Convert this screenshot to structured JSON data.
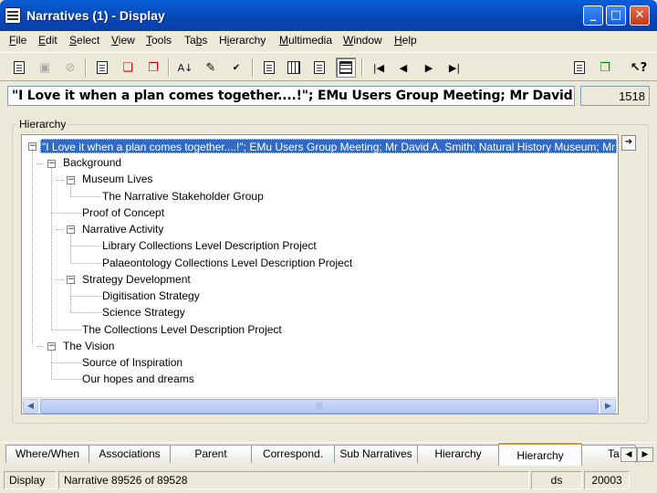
{
  "window": {
    "title": "Narratives (1) - Display",
    "buttons": {
      "minimize": "_",
      "maximize": "□",
      "close": "✕"
    }
  },
  "menu": [
    {
      "label": "File",
      "accel": "F",
      "rest": "ile"
    },
    {
      "label": "Edit",
      "accel": "E",
      "rest": "dit"
    },
    {
      "label": "Select",
      "accel": "S",
      "rest": "elect"
    },
    {
      "label": "View",
      "accel": "V",
      "rest": "iew"
    },
    {
      "label": "Tools",
      "accel": "T",
      "rest": "ools"
    },
    {
      "label": "Tabs",
      "pre": "Ta",
      "accel": "b",
      "rest": "s"
    },
    {
      "label": "Hierarchy",
      "pre": "H",
      "accel": "i",
      "rest": "erarchy"
    },
    {
      "label": "Multimedia",
      "accel": "M",
      "rest": "ultimedia"
    },
    {
      "label": "Window",
      "accel": "W",
      "rest": "indow"
    },
    {
      "label": "Help",
      "accel": "H",
      "rest": "elp"
    }
  ],
  "toolbar_icons": [
    "new-record-icon",
    "save-icon",
    "cancel-icon",
    "search-icon",
    "search-options-icon",
    "clear-icon",
    "sort-icon",
    "edit-icon",
    "spell-check-icon",
    "page-view-icon",
    "list-view-icon",
    "detail-view-icon",
    "hierarchy-view-icon",
    "first-record-icon",
    "previous-record-icon",
    "next-record-icon",
    "last-record-icon",
    "copy-record-icon",
    "duplicate-record-icon",
    "whats-this-help-icon"
  ],
  "summary": {
    "text": "\"I Love it when a plan comes together....!\"; EMu Users Group Meeting; Mr David A. Smith; Natur",
    "record_number": "1518"
  },
  "hierarchy": {
    "group_label": "Hierarchy",
    "root": "\"I Love it when a plan comes together....!\"; EMu Users Group Meeting; Mr David A. Smith; Natural History Museum; Mr",
    "nodes": {
      "background": "Background",
      "museum_lives": "Museum Lives",
      "stakeholder": "The Narrative Stakeholder Group",
      "proof": "Proof of Concept",
      "narrative_activity": "Narrative Activity",
      "library": "Library Collections Level Description Project",
      "palaeontology": "Palaeontology Collections Level Description Project",
      "strategy": "Strategy Development",
      "digitisation": "Digitisation Strategy",
      "science": "Science Strategy",
      "clds_project": "The Collections Level Description Project",
      "vision": "The Vision",
      "inspiration": "Source of Inspiration",
      "hopes": "Our hopes and dreams"
    },
    "toggles": {
      "expanded": "−"
    },
    "scroll": {
      "left": "◀",
      "right": "▶",
      "grip": "|||"
    },
    "side_button": "➔"
  },
  "tabs": {
    "where_when": "Where/When",
    "associations": "Associations",
    "parent": "Parent",
    "correspond": "Correspond.",
    "sub_narratives": "Sub Narratives",
    "hierarchy": "Hierarchy",
    "hierarchy_active": "Hierarchy",
    "truncated": "Ta",
    "scroll_left": "◀",
    "scroll_right": "▶"
  },
  "status": {
    "mode": "Display",
    "record_info": "Narrative 89526 of 89528",
    "user": "ds",
    "year": "20003"
  }
}
